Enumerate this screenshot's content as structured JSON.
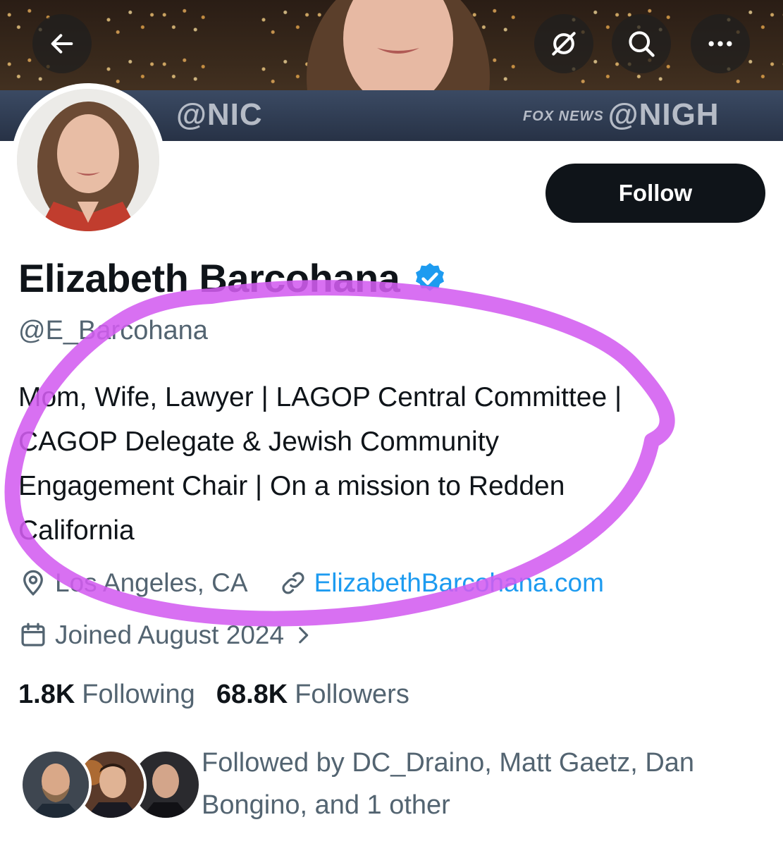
{
  "banner": {
    "ticker_left": "@NIC",
    "ticker_right_brand": "FOX NEWS",
    "ticker_right": "@NIGH"
  },
  "header": {
    "back_icon": "arrow-left-icon",
    "grok_icon": "grok-icon",
    "search_icon": "search-icon",
    "more_icon": "more-horizontal-icon"
  },
  "profile": {
    "display_name": "Elizabeth Barcohana",
    "handle": "@E_Barcohana",
    "verified": true,
    "verified_color": "#1d9bf0",
    "bio": "Mom, Wife, Lawyer | LAGOP Central Committee |\nCAGOP Delegate & Jewish Community\nEngagement Chair | On a mission to Redden\nCalifornia",
    "location": "Los Angeles, CA",
    "website": "ElizabethBarcohana.com",
    "joined": "Joined August 2024"
  },
  "actions": {
    "follow_label": "Follow"
  },
  "stats": {
    "following_count": "1.8K",
    "following_label": "Following",
    "followers_count": "68.8K",
    "followers_label": "Followers"
  },
  "followed_by": {
    "text": "Followed by DC_Draino, Matt Gaetz, Dan Bongino, and 1 other"
  },
  "colors": {
    "text_primary": "#0f1419",
    "text_secondary": "#536471",
    "link": "#1d9bf0",
    "annotation": "#d35cf0"
  }
}
